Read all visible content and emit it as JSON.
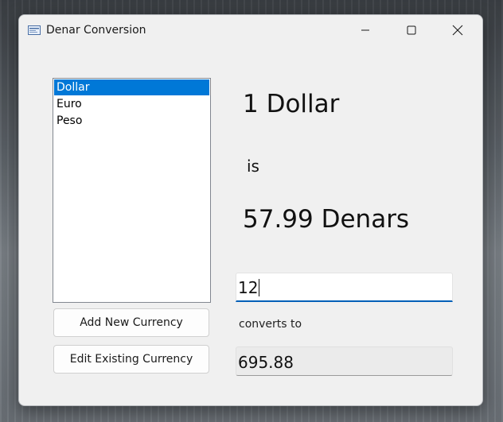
{
  "window": {
    "title": "Denar Conversion",
    "icon": "app-icon"
  },
  "titlebar": {
    "minimize_icon": "minimize-icon",
    "maximize_icon": "maximize-icon",
    "close_icon": "close-icon"
  },
  "currency_list": {
    "items": [
      "Dollar",
      "Euro",
      "Peso"
    ],
    "selected_index": 0
  },
  "buttons": {
    "add": "Add New Currency",
    "edit": "Edit Existing Currency"
  },
  "rate_display": {
    "amount": "1 Dollar",
    "is": "is",
    "value": "57.99 Denars"
  },
  "converter": {
    "input_value": "12",
    "converts_to": "converts to",
    "output_value": "695.88"
  },
  "colors": {
    "selection": "#0078d7",
    "input_focus_underline": "#005fb8"
  }
}
